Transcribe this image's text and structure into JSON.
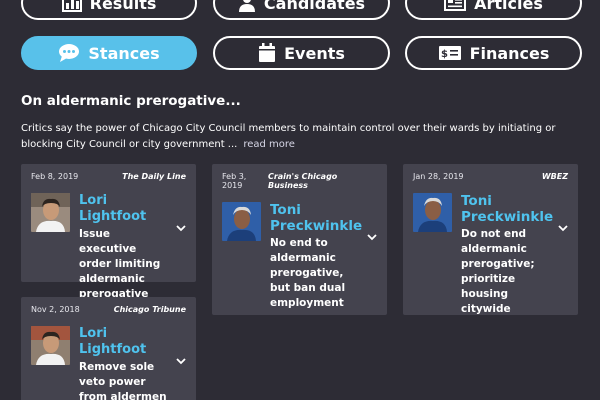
{
  "tabs": {
    "results": "Results",
    "candidates": "Candidates",
    "articles": "Articles",
    "stances": "Stances",
    "events": "Events",
    "finances": "Finances"
  },
  "active_tab": "Stances",
  "topic": {
    "heading": "On aldermanic prerogative...",
    "description": "Critics say the power of Chicago City Council members to maintain control over their wards by initiating or blocking City Council or city government ...",
    "read_more": "read more"
  },
  "cards": [
    {
      "date": "Feb 8, 2019",
      "source": "The Daily Line",
      "candidate": "Lori Lightfoot",
      "stance": "Issue executive order limiting aldermanic prerogative"
    },
    {
      "date": "Feb 3, 2019",
      "source": "Crain's Chicago Business",
      "candidate": "Toni Preckwinkle",
      "stance": "No end to aldermanic prerogative, but ban dual employment"
    },
    {
      "date": "Jan 28, 2019",
      "source": "WBEZ",
      "candidate": "Toni Preckwinkle",
      "stance": "Do not end aldermanic prerogative; prioritize housing citywide"
    },
    {
      "date": "Nov 2, 2018",
      "source": "Chicago Tribune",
      "candidate": "Lori Lightfoot",
      "stance": "Remove sole veto power from aldermen"
    }
  ],
  "colors": {
    "background": "#2d2c35",
    "card": "#44434e",
    "accent": "#58c1ea",
    "name": "#4fc3ee"
  },
  "icons": {
    "results": "bar-chart-icon",
    "candidates": "person-icon",
    "articles": "newspaper-icon",
    "stances": "speech-bubble-icon",
    "events": "calendar-icon",
    "finances": "dollar-bill-icon",
    "expand": "chevron-down-icon"
  }
}
